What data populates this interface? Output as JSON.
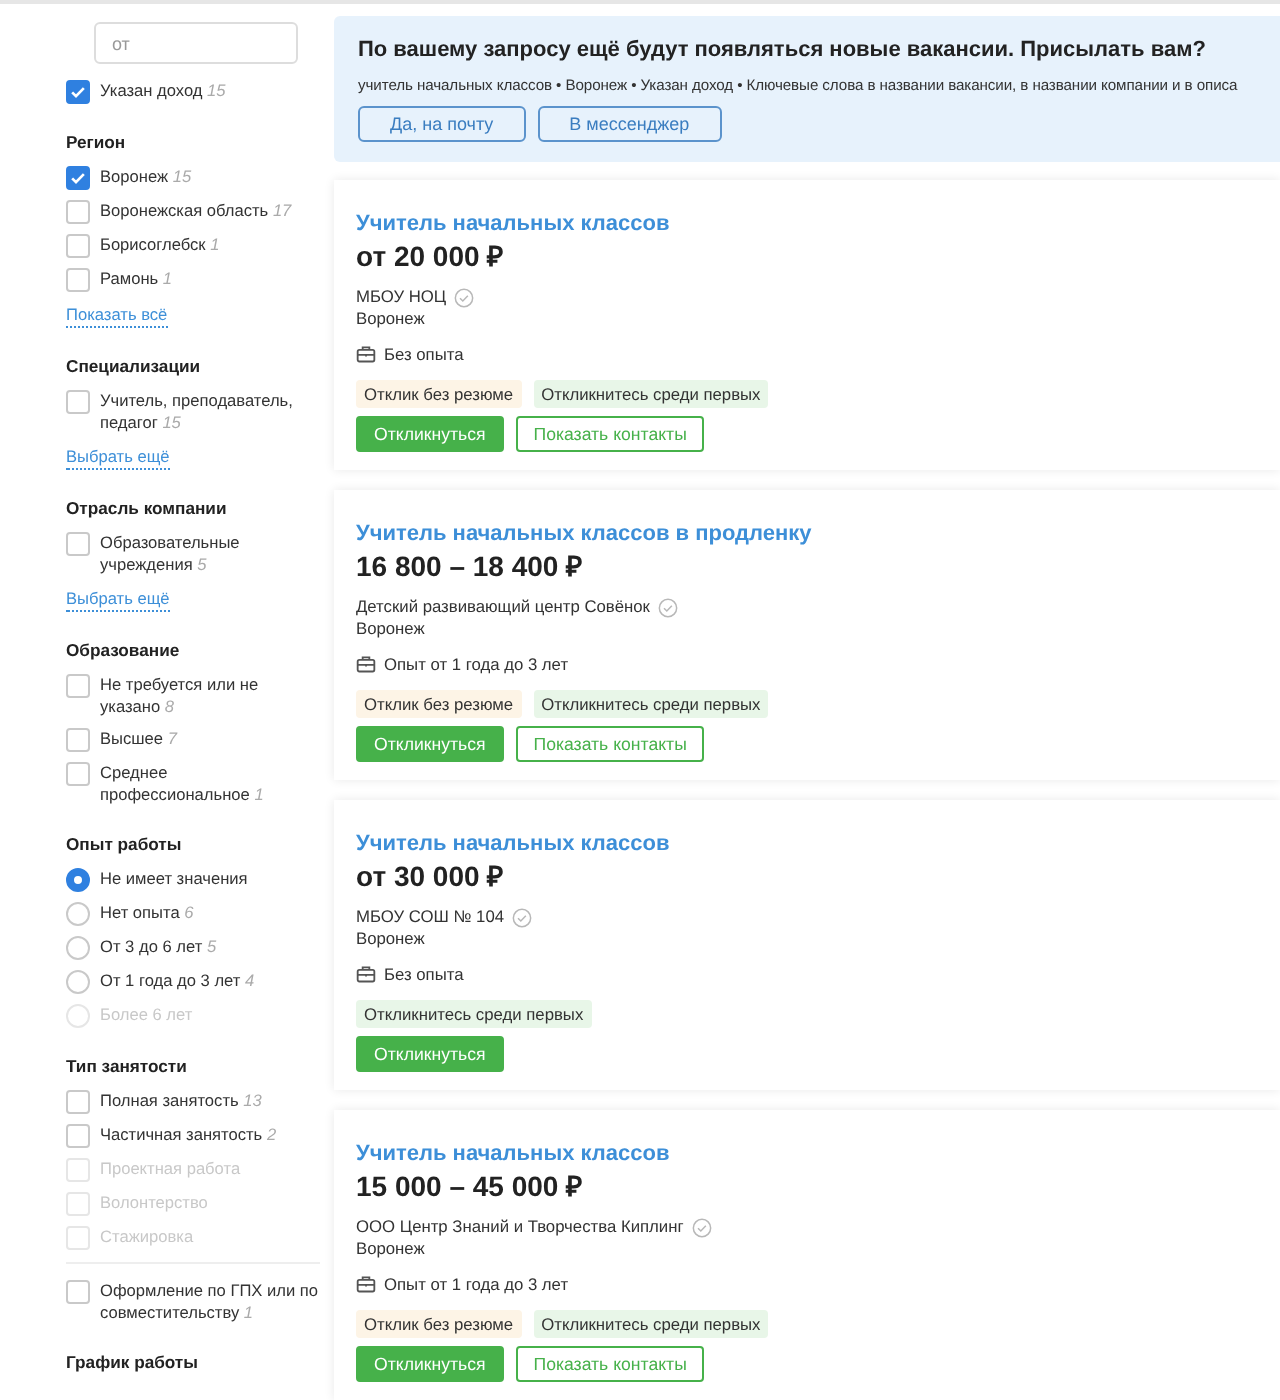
{
  "filters": [
    {
      "placeholder": "от",
      "items": [
        {
          "kind": "checkbox",
          "label": "Указан доход",
          "count": "15",
          "checked": true,
          "disabled": false
        }
      ]
    },
    {
      "title": "Регион",
      "items": [
        {
          "kind": "checkbox",
          "label": "Воронеж",
          "count": "15",
          "checked": true,
          "disabled": false
        },
        {
          "kind": "checkbox",
          "label": "Воронежская область",
          "count": "17",
          "checked": false,
          "disabled": false
        },
        {
          "kind": "checkbox",
          "label": "Борисоглебск",
          "count": "1",
          "checked": false,
          "disabled": false
        },
        {
          "kind": "checkbox",
          "label": "Рамонь",
          "count": "1",
          "checked": false,
          "disabled": false
        }
      ],
      "link": "Показать всё"
    },
    {
      "title": "Специализации",
      "items": [
        {
          "kind": "checkbox",
          "label": "Учитель, преподаватель, педагог",
          "count": "15",
          "checked": false,
          "disabled": false
        }
      ],
      "link": "Выбрать ещё"
    },
    {
      "title": "Отрасль компании",
      "items": [
        {
          "kind": "checkbox",
          "label": "Образовательные учреждения",
          "count": "5",
          "checked": false,
          "disabled": false
        }
      ],
      "link": "Выбрать ещё"
    },
    {
      "title": "Образование",
      "items": [
        {
          "kind": "checkbox",
          "label": "Не требуется или не указано",
          "count": "8",
          "checked": false,
          "disabled": false
        },
        {
          "kind": "checkbox",
          "label": "Высшее",
          "count": "7",
          "checked": false,
          "disabled": false
        },
        {
          "kind": "checkbox",
          "label": "Среднее профессиональное",
          "count": "1",
          "checked": false,
          "disabled": false
        }
      ]
    },
    {
      "title": "Опыт работы",
      "items": [
        {
          "kind": "radio",
          "label": "Не имеет значения",
          "selected": true,
          "disabled": false
        },
        {
          "kind": "radio",
          "label": "Нет опыта",
          "count": "6",
          "selected": false,
          "disabled": false
        },
        {
          "kind": "radio",
          "label": "От 3 до 6 лет",
          "count": "5",
          "selected": false,
          "disabled": false
        },
        {
          "kind": "radio",
          "label": "От 1 года до 3 лет",
          "count": "4",
          "selected": false,
          "disabled": false
        },
        {
          "kind": "radio",
          "label": "Более 6 лет",
          "selected": false,
          "disabled": true
        }
      ]
    },
    {
      "title": "Тип занятости",
      "items": [
        {
          "kind": "checkbox",
          "label": "Полная занятость",
          "count": "13",
          "checked": false,
          "disabled": false
        },
        {
          "kind": "checkbox",
          "label": "Частичная занятость",
          "count": "2",
          "checked": false,
          "disabled": false
        },
        {
          "kind": "checkbox",
          "label": "Проектная работа",
          "checked": false,
          "disabled": true
        },
        {
          "kind": "checkbox",
          "label": "Волонтерство",
          "checked": false,
          "disabled": true
        },
        {
          "kind": "checkbox",
          "label": "Стажировка",
          "checked": false,
          "disabled": true
        },
        {
          "kind": "divider"
        },
        {
          "kind": "checkbox",
          "label": "Оформление по ГПХ или по совместительству",
          "count": "1",
          "checked": false,
          "disabled": false
        }
      ]
    },
    {
      "title": "График работы"
    }
  ],
  "subscription": {
    "title": "По вашему запросу ещё будут появляться новые вакансии. Присылать вам?",
    "query": "учитель начальных классов • Воронеж • Указан доход • Ключевые слова в названии вакансии, в названии компании и в описа",
    "buttons": [
      "Да, на почту",
      "В мессенджер"
    ]
  },
  "vacancies": [
    {
      "title": "Учитель начальных классов",
      "salary": "от 20 000 ₽",
      "company": "МБОУ НОЦ",
      "verified": true,
      "city": "Воронеж",
      "experience": "Без опыта",
      "tags": [
        {
          "kind": "no-resume",
          "label": "Отклик без резюме"
        },
        {
          "kind": "first",
          "label": "Откликнитесь среди первых"
        }
      ],
      "buttons": [
        {
          "kind": "primary",
          "label": "Откликнуться"
        },
        {
          "kind": "outline",
          "label": "Показать контакты"
        }
      ]
    },
    {
      "title": "Учитель начальных классов в продленку",
      "salary": "16 800 – 18 400 ₽",
      "company": "Детский развивающий центр Совёнок",
      "verified": true,
      "city": "Воронеж",
      "experience": "Опыт от 1 года до 3 лет",
      "tags": [
        {
          "kind": "no-resume",
          "label": "Отклик без резюме"
        },
        {
          "kind": "first",
          "label": "Откликнитесь среди первых"
        }
      ],
      "buttons": [
        {
          "kind": "primary",
          "label": "Откликнуться"
        },
        {
          "kind": "outline",
          "label": "Показать контакты"
        }
      ]
    },
    {
      "title": "Учитель начальных классов",
      "salary": "от 30 000 ₽",
      "company": "МБОУ СОШ № 104",
      "verified": true,
      "city": "Воронеж",
      "experience": "Без опыта",
      "tags": [
        {
          "kind": "first",
          "label": "Откликнитесь среди первых"
        }
      ],
      "buttons": [
        {
          "kind": "primary",
          "label": "Откликнуться"
        }
      ]
    },
    {
      "title": "Учитель начальных классов",
      "salary": "15 000 – 45 000 ₽",
      "company": "ООО Центр Знаний и Творчества Киплинг",
      "verified": true,
      "city": "Воронеж",
      "experience": "Опыт от 1 года до 3 лет",
      "tags": [
        {
          "kind": "no-resume",
          "label": "Отклик без резюме"
        },
        {
          "kind": "first",
          "label": "Откликнитесь среди первых"
        }
      ],
      "buttons": [
        {
          "kind": "primary",
          "label": "Откликнуться"
        },
        {
          "kind": "outline",
          "label": "Показать контакты"
        }
      ]
    }
  ]
}
